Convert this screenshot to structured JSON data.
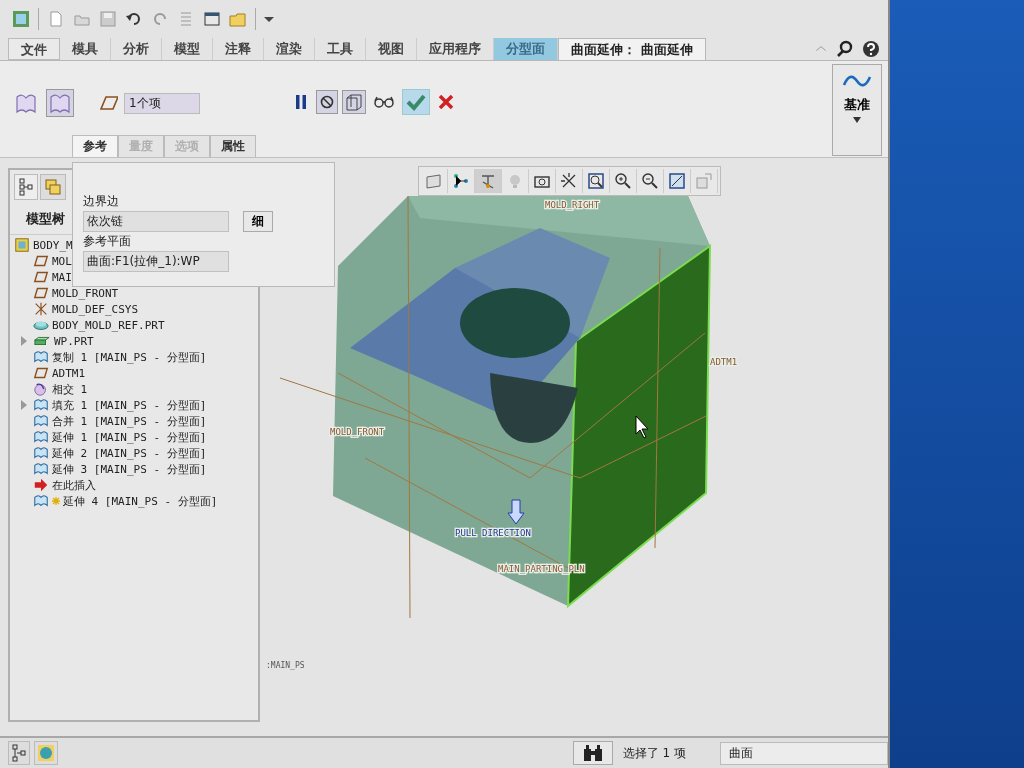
{
  "ribbon_tabs": [
    {
      "label": "文件",
      "kind": "menu",
      "selected": false,
      "contextual": false
    },
    {
      "label": "模具",
      "kind": "tab",
      "selected": false,
      "contextual": false
    },
    {
      "label": "分析",
      "kind": "tab",
      "selected": false,
      "contextual": false
    },
    {
      "label": "模型",
      "kind": "tab",
      "selected": false,
      "contextual": false
    },
    {
      "label": "注释",
      "kind": "tab",
      "selected": false,
      "contextual": false
    },
    {
      "label": "渲染",
      "kind": "tab",
      "selected": false,
      "contextual": false
    },
    {
      "label": "工具",
      "kind": "tab",
      "selected": false,
      "contextual": false
    },
    {
      "label": "视图",
      "kind": "tab",
      "selected": false,
      "contextual": false
    },
    {
      "label": "应用程序",
      "kind": "tab",
      "selected": false,
      "contextual": false
    },
    {
      "label": "分型面",
      "kind": "tab",
      "selected": false,
      "contextual": true
    },
    {
      "label": "曲面延伸： 曲面延伸",
      "kind": "tab",
      "selected": true,
      "contextual": false
    }
  ],
  "ribbon": {
    "extend_type_buttons": [
      {
        "selected": false
      },
      {
        "selected": true
      }
    ],
    "reference_field": {
      "value": "1个项"
    },
    "datum_button": {
      "label": "基准"
    }
  },
  "sub_tabs": [
    {
      "label": "参考",
      "selected": true,
      "disabled": false
    },
    {
      "label": "量度",
      "selected": false,
      "disabled": true
    },
    {
      "label": "选项",
      "selected": false,
      "disabled": true
    },
    {
      "label": "属性",
      "selected": false,
      "disabled": false
    }
  ],
  "references_panel": {
    "boundary_label": "边界边",
    "boundary_field": {
      "value": "依次链"
    },
    "details_button": "细",
    "plane_label": "参考平面",
    "plane_field": {
      "value": "曲面:F1(拉伸_1):WP"
    }
  },
  "model_tree": {
    "heading": "模型树",
    "items": [
      {
        "label": "BODY_M",
        "kind": "assembly",
        "children": [
          {
            "label": "MOL",
            "kind": "datum_plane"
          },
          {
            "label": "MAI",
            "kind": "datum_plane"
          },
          {
            "label": "MOLD_FRONT",
            "kind": "datum_plane"
          },
          {
            "label": "MOLD_DEF_CSYS",
            "kind": "csys"
          },
          {
            "label": "BODY_MOLD_REF.PRT",
            "kind": "part"
          },
          {
            "label": "WP.PRT",
            "kind": "workpiece",
            "expanded": false
          },
          {
            "label": "复制 1 [MAIN_PS - 分型面]",
            "kind": "surface"
          },
          {
            "label": "ADTM1",
            "kind": "datum_plane"
          },
          {
            "label": "相交 1",
            "kind": "intersect"
          },
          {
            "label": "填充 1 [MAIN_PS - 分型面]",
            "kind": "surface",
            "expanded": false
          },
          {
            "label": "合并 1 [MAIN_PS - 分型面]",
            "kind": "surface"
          },
          {
            "label": "延伸 1 [MAIN_PS - 分型面]",
            "kind": "surface"
          },
          {
            "label": "延伸 2 [MAIN_PS - 分型面]",
            "kind": "surface"
          },
          {
            "label": "延伸 3 [MAIN_PS - 分型面]",
            "kind": "surface"
          },
          {
            "label": "在此插入",
            "kind": "insert"
          },
          {
            "label": "延伸 4 [MAIN_PS - 分型面]",
            "kind": "surface",
            "new": true
          }
        ]
      }
    ]
  },
  "viewport": {
    "labels": [
      {
        "text": "MOLD_RIGHT",
        "kind": "datum"
      },
      {
        "text": "ADTM1",
        "kind": "datum"
      },
      {
        "text": "MOLD_FRONT",
        "kind": "datum"
      },
      {
        "text": "PULL DIRECTION",
        "kind": "direction"
      },
      {
        "text": "MAIN_PARTING_PLN",
        "kind": "datum"
      }
    ],
    "quilt_label": ":MAIN_PS"
  },
  "status_bar": {
    "selection_text": "选择了 1 项",
    "filter": "曲面"
  }
}
